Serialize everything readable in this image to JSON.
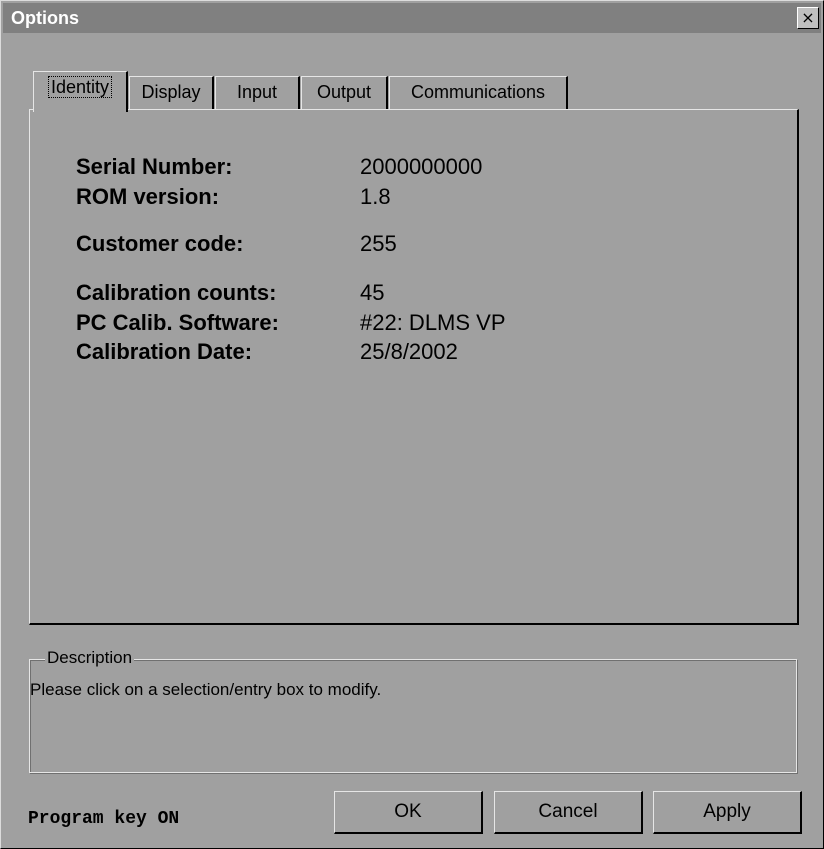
{
  "window": {
    "title": "Options",
    "close_glyph": "×"
  },
  "tabs": [
    {
      "label": "Identity",
      "active": true
    },
    {
      "label": "Display"
    },
    {
      "label": "Input"
    },
    {
      "label": "Output"
    },
    {
      "label": "Communications"
    }
  ],
  "identity": {
    "serial_label": "Serial Number:",
    "serial_value": "2000000000",
    "rom_label": "ROM version:",
    "rom_value": "1.8",
    "customer_label": "Customer code:",
    "customer_value": "255",
    "calcounts_label": "Calibration counts:",
    "calcounts_value": "45",
    "pccal_label": "PC Calib. Software:",
    "pccal_value": "#22: DLMS VP",
    "caldate_label": "Calibration Date:",
    "caldate_value": "25/8/2002"
  },
  "description": {
    "legend": "Description",
    "text": "Please click on a selection/entry box to modify."
  },
  "status": {
    "program_key": "Program key ON"
  },
  "buttons": {
    "ok": "OK",
    "cancel": "Cancel",
    "apply": "Apply"
  }
}
